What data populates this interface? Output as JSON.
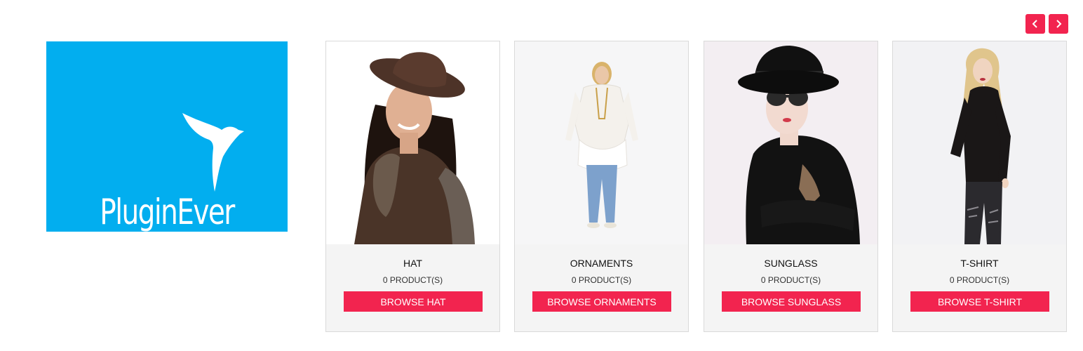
{
  "brand": {
    "name": "PluginEver",
    "background": "#02aeef",
    "icon": "bird-logo-icon"
  },
  "carousel": {
    "prev_icon": "chevron-left-icon",
    "next_icon": "chevron-right-icon",
    "accent": "#f2244f"
  },
  "categories": [
    {
      "title": "HAT",
      "count": "0 PRODUCT(S)",
      "button": "BROWSE HAT",
      "image": "woman-in-brown-hat-photo"
    },
    {
      "title": "ORNAMENTS",
      "count": "0 PRODUCT(S)",
      "button": "BROWSE ORNAMENTS",
      "image": "woman-in-white-top-photo"
    },
    {
      "title": "SUNGLASS",
      "count": "0 PRODUCT(S)",
      "button": "BROWSE SUNGLASS",
      "image": "woman-in-sunglasses-photo"
    },
    {
      "title": "T-SHIRT",
      "count": "0 PRODUCT(S)",
      "button": "BROWSE T-SHIRT",
      "image": "woman-in-black-top-photo"
    }
  ]
}
